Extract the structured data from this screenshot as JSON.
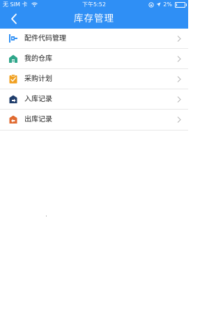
{
  "status_bar": {
    "carrier": "无 SIM 卡",
    "time": "下午5:52",
    "battery": "2%"
  },
  "nav": {
    "title": "库存管理",
    "back_icon": "chevron-left-icon"
  },
  "menu": {
    "items": [
      {
        "label": "配件代码管理",
        "icon": "parts-code-icon",
        "color": "#2f8ff5"
      },
      {
        "label": "我的仓库",
        "icon": "warehouse-icon",
        "color": "#2fa68a"
      },
      {
        "label": "采购计划",
        "icon": "purchase-plan-icon",
        "color": "#f0a020"
      },
      {
        "label": "入库记录",
        "icon": "inbound-record-icon",
        "color": "#1f3d6b"
      },
      {
        "label": "出库记录",
        "icon": "outbound-record-icon",
        "color": "#e06a30"
      }
    ]
  },
  "colors": {
    "primary": "#2f8ff5",
    "divider": "#e8e8e8",
    "chevron": "#b8b8b8"
  }
}
